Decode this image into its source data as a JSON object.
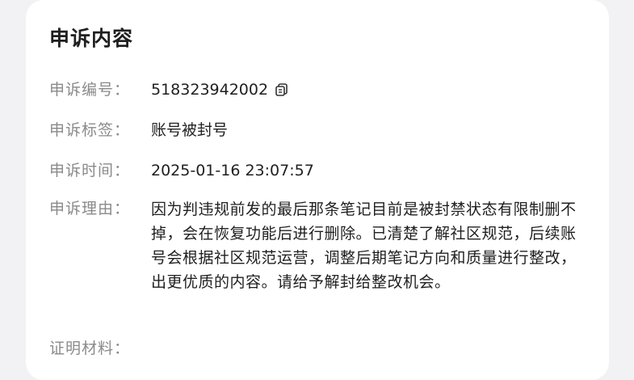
{
  "card": {
    "title": "申诉内容"
  },
  "fields": {
    "appeal_id": {
      "label": "申诉编号：",
      "value": "518323942002",
      "icon": "copy-icon"
    },
    "appeal_tag": {
      "label": "申诉标签：",
      "value": "账号被封号"
    },
    "appeal_time": {
      "label": "申诉时间：",
      "value": "2025-01-16 23:07:57"
    },
    "appeal_reason": {
      "label": "申诉理由：",
      "value": "因为判违规前发的最后那条笔记目前是被封禁状态有限制删不掉，会在恢复功能后进行删除。已清楚了解社区规范，后续账号会根据社区规范运营，调整后期笔记方向和质量进行整改，出更优质的内容。请给予解封给整改机会。"
    },
    "evidence": {
      "label": "证明材料："
    }
  }
}
